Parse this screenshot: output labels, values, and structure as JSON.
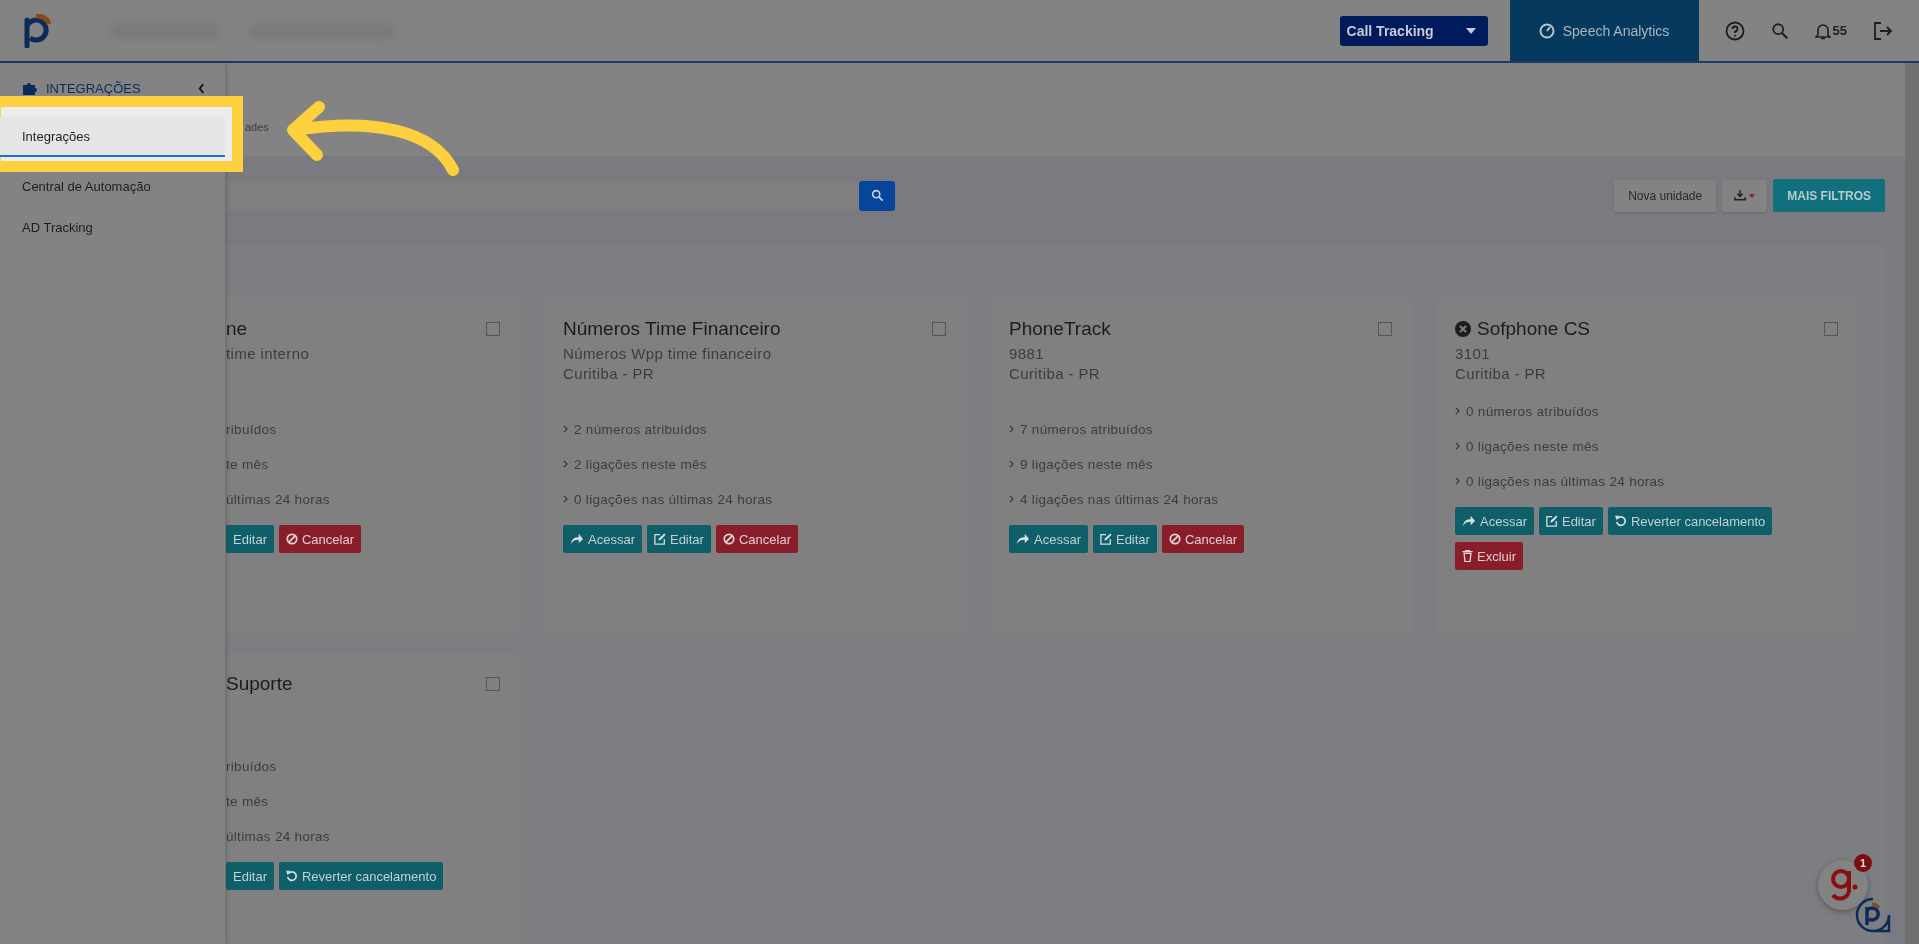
{
  "topbar": {
    "product_select": "Call Tracking",
    "speech_tab": "Speech Analytics",
    "notification_count": "55"
  },
  "sidebar": {
    "section": "INTEGRAÇÕES",
    "items": [
      {
        "label": "Integrações",
        "selected": true
      },
      {
        "label": "Central de Automação",
        "selected": false
      },
      {
        "label": "AD Tracking",
        "selected": false
      }
    ]
  },
  "breadcrumb": "ades",
  "toolbar": {
    "new_button": "Nova unidade",
    "filters_button": "MAIS FILTROS"
  },
  "cards": [
    {
      "partial": true,
      "canceled": false,
      "checked": false,
      "title": "ne",
      "lines": [
        "time interno"
      ],
      "stats": [
        "ribuídos",
        "te mês",
        "últimas 24 horas"
      ],
      "actions": [
        {
          "label": "Editar",
          "kind": "edit"
        },
        {
          "label": "Cancelar",
          "kind": "cancel"
        }
      ]
    },
    {
      "partial": false,
      "canceled": false,
      "checked": false,
      "title": "Números Time Financeiro",
      "lines": [
        "Números Wpp time financeiro",
        "Curitiba - PR"
      ],
      "stats": [
        "2 números atribuídos",
        "2 ligações neste mês",
        "0 ligações nas últimas 24 horas"
      ],
      "actions": [
        {
          "label": "Acessar",
          "kind": "access"
        },
        {
          "label": "Editar",
          "kind": "edit"
        },
        {
          "label": "Cancelar",
          "kind": "cancel"
        }
      ]
    },
    {
      "partial": false,
      "canceled": false,
      "checked": false,
      "title": "PhoneTrack",
      "lines": [
        "9881",
        "Curitiba - PR"
      ],
      "stats": [
        "7 números atribuídos",
        "9 ligações neste mês",
        "4 ligações nas últimas 24 horas"
      ],
      "actions": [
        {
          "label": "Acessar",
          "kind": "access"
        },
        {
          "label": "Editar",
          "kind": "edit"
        },
        {
          "label": "Cancelar",
          "kind": "cancel"
        }
      ]
    },
    {
      "partial": false,
      "canceled": true,
      "checked": false,
      "title": "Sofphone CS",
      "lines": [
        "3101",
        "Curitiba - PR"
      ],
      "stats": [
        "0 números atribuídos",
        "0 ligações neste mês",
        "0 ligações nas últimas 24 horas"
      ],
      "actions": [
        {
          "label": "Acessar",
          "kind": "access"
        },
        {
          "label": "Editar",
          "kind": "edit"
        },
        {
          "label": "Reverter cancelamento",
          "kind": "revert"
        },
        {
          "label": "Excluir",
          "kind": "delete"
        }
      ]
    },
    {
      "partial": true,
      "canceled": true,
      "checked": false,
      "title": "Suporte",
      "stats": [
        "ribuídos",
        "te mês",
        "últimas 24 horas"
      ],
      "actions": [
        {
          "label": "Editar",
          "kind": "edit"
        },
        {
          "label": "Reverter cancelamento",
          "kind": "revert"
        }
      ]
    }
  ],
  "chat_badge": "1"
}
